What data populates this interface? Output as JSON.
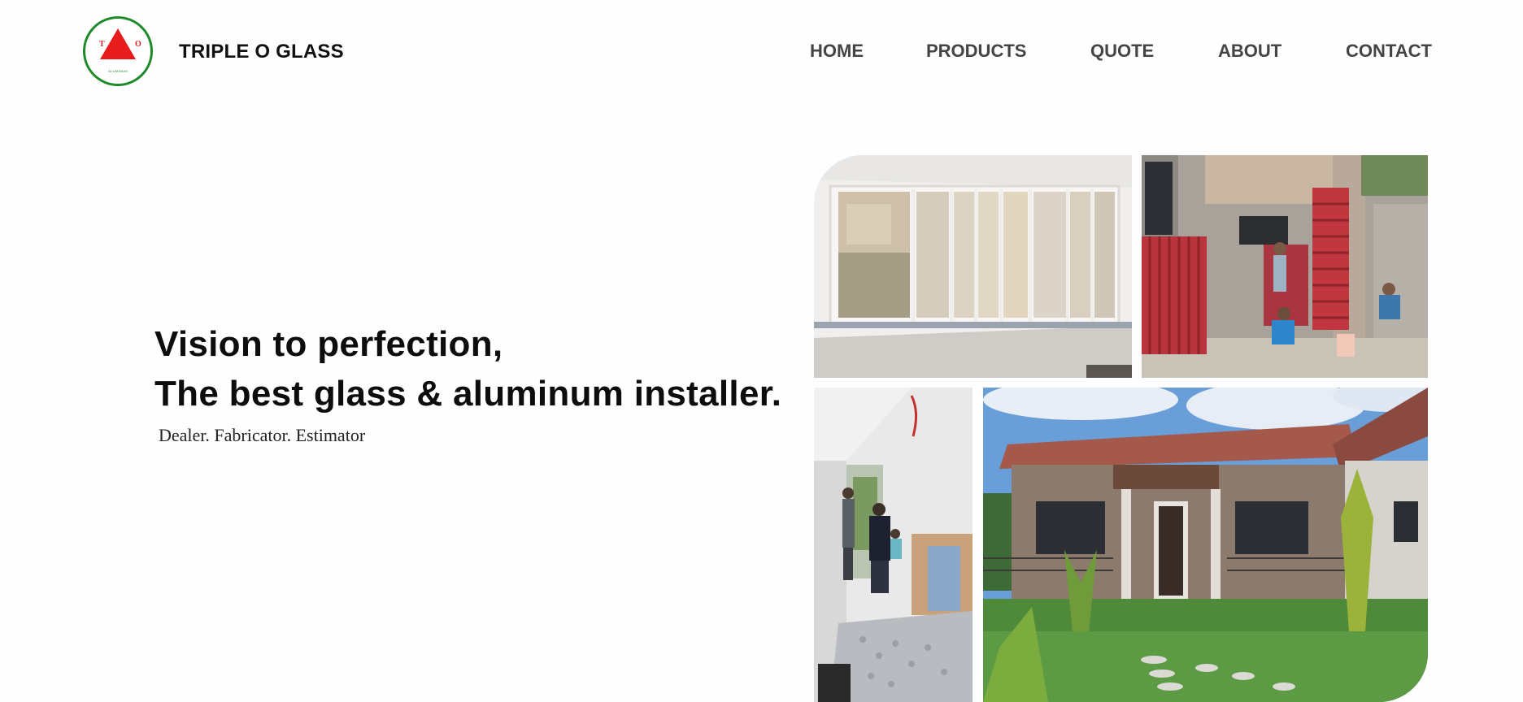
{
  "brand": {
    "name": "TRIPLE O GLASS",
    "logo_letter_left": "T",
    "logo_letter_right": "O",
    "logo_subtext": "ALUMINUM",
    "logo_colors": {
      "ring": "#1e8a2a",
      "triangle": "#e81c1c"
    }
  },
  "nav": {
    "items": [
      {
        "label": "HOME"
      },
      {
        "label": "PRODUCTS"
      },
      {
        "label": "QUOTE"
      },
      {
        "label": "ABOUT"
      },
      {
        "label": "CONTACT"
      }
    ]
  },
  "hero": {
    "headline_line1": "Vision to perfection,",
    "headline_line2": "The best glass & aluminum installer.",
    "tagline": "Dealer. Fabricator. Estimator"
  },
  "gallery": {
    "images": [
      {
        "subject": "glass-sliding-doors-photo"
      },
      {
        "subject": "red-gate-installation-photo"
      },
      {
        "subject": "workers-interior-installation-photo"
      },
      {
        "subject": "bungalow-house-exterior-photo"
      }
    ]
  },
  "colors": {
    "nav_text": "#444444",
    "heading": "#0d0d0d",
    "background": "#fefefe"
  }
}
